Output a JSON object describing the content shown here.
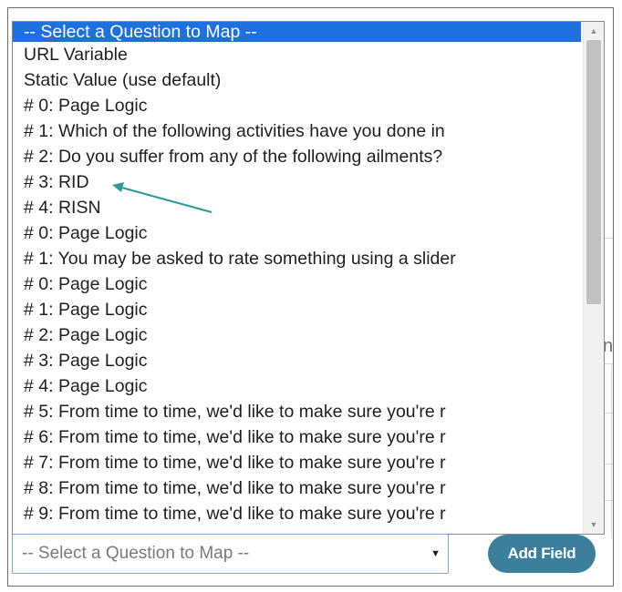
{
  "listbox": {
    "options": [
      "-- Select a Question to Map --",
      "URL Variable",
      "Static Value (use default)",
      "# 0: Page Logic",
      "# 1: Which of the following activities have you done in",
      "# 2: Do you suffer from any of the following ailments?",
      "# 3: RID",
      "# 4: RISN",
      "# 0: Page Logic",
      "# 1: You may be asked to rate something using a slider",
      "# 0: Page Logic",
      "# 1: Page Logic",
      "# 2: Page Logic",
      "# 3: Page Logic",
      "# 4: Page Logic",
      "# 5: From time to time, we'd like to make sure you're r",
      "# 6: From time to time, we'd like to make sure you're r",
      "# 7: From time to time, we'd like to make sure you're r",
      "# 8: From time to time, we'd like to make sure you're r",
      "# 9: From time to time, we'd like to make sure you're r"
    ],
    "selected_index": 0,
    "highlighted_option": "# 3: RID"
  },
  "select": {
    "value": "-- Select a Question to Map --"
  },
  "add_field_button": {
    "label": "Add Field"
  },
  "background": {
    "fragment_text": "ne"
  },
  "colors": {
    "selection": "#1e6fe0",
    "annotation_arrow": "#2a9a9a",
    "button": "#3b7f9c"
  },
  "icons": {
    "scroll_up": "triangle-up",
    "scroll_down": "triangle-down",
    "select_caret": "triangle-down"
  }
}
